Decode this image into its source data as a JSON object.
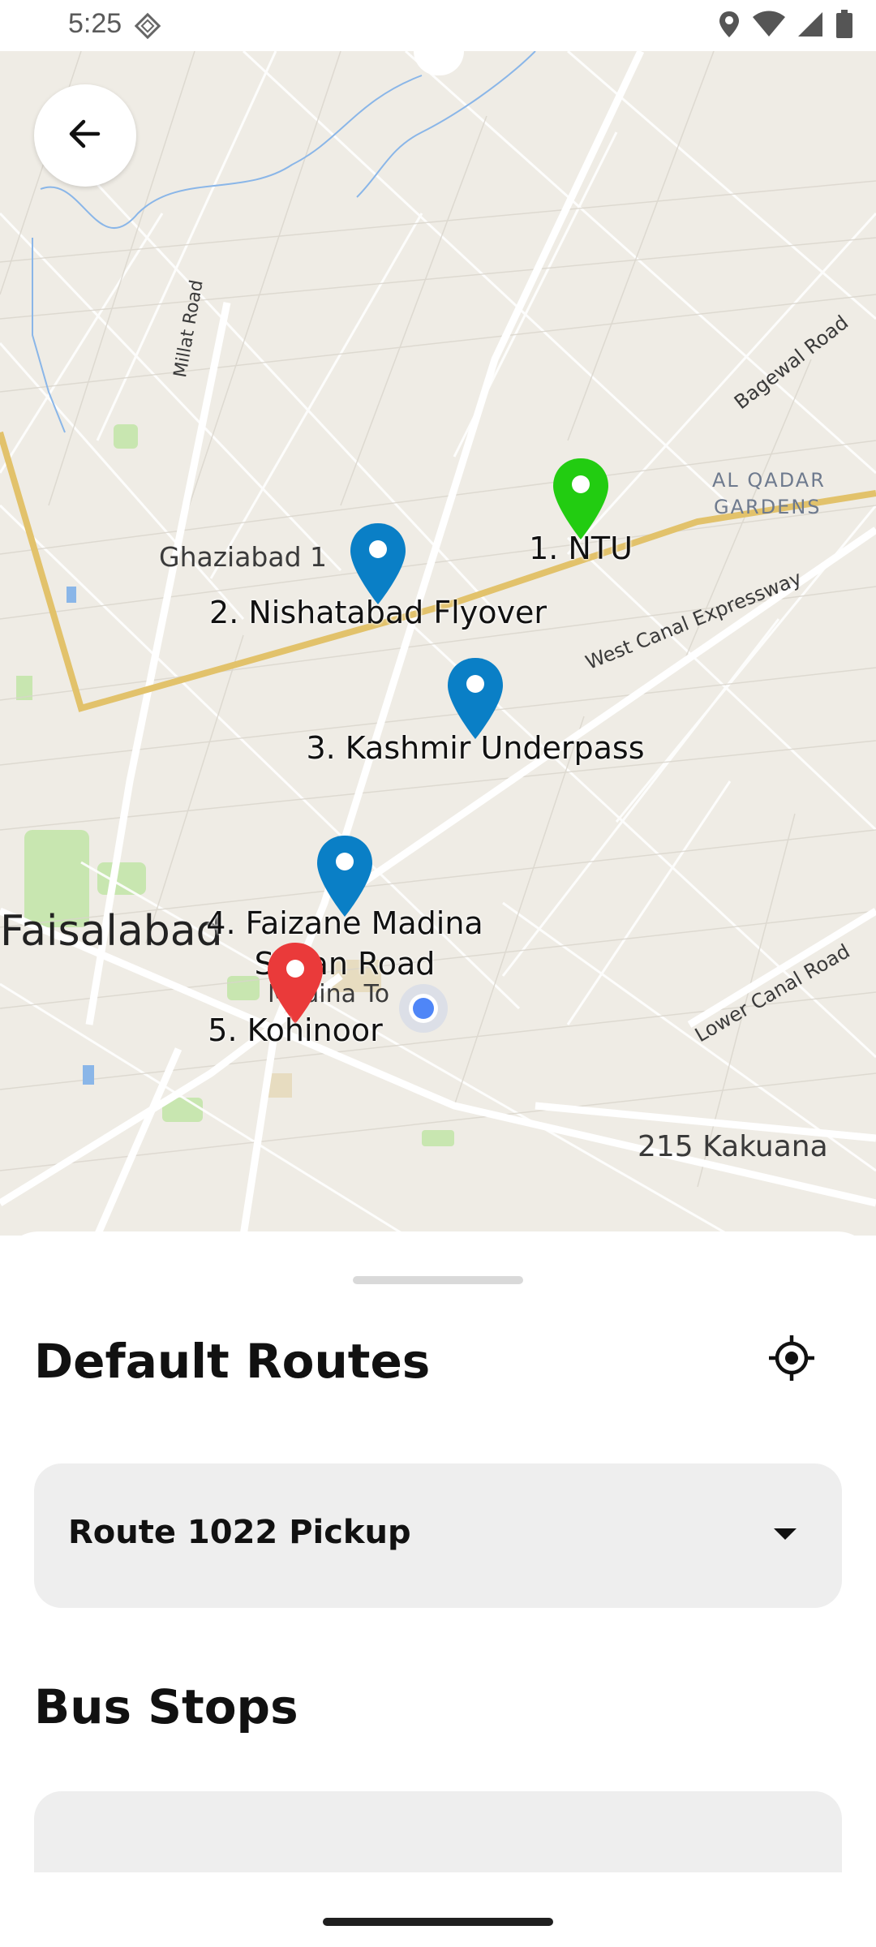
{
  "status_bar": {
    "time": "5:25",
    "left_icon": "screenshot-icon",
    "icons": [
      "location-icon",
      "wifi-icon",
      "signal-icon",
      "battery-icon"
    ]
  },
  "map": {
    "area_labels": {
      "city": "Faisalabad",
      "ghaziabad": "Ghaziabad 1",
      "millat_road": "Millat Road",
      "bagewal_road": "Bagewal Road",
      "al_qadar_1": "AL QADAR",
      "al_qadar_2": "GARDENS",
      "west_canal": "West Canal Expressway",
      "lower_canal": "Lower Canal Road",
      "kakuana": "215 Kakuana",
      "madina_town": "Madina To"
    },
    "stops": [
      {
        "label": "1. NTU",
        "color": "#22cc11"
      },
      {
        "label": "2. Nishatabad Flyover",
        "color": "#0a7fc6"
      },
      {
        "label": "3. Kashmir Underpass",
        "color": "#0a7fc6"
      },
      {
        "label_line1": "4. Faizane Madina",
        "label_line2": "Susan Road",
        "color": "#0a7fc6"
      },
      {
        "label": "5. Kohinoor",
        "color": "#ea3a3a"
      }
    ],
    "current_location_color": "#4f86f7"
  },
  "back_button_icon": "arrow-left-icon",
  "sheet": {
    "default_routes_title": "Default Routes",
    "locate_icon": "my-location-icon",
    "route_selected": "Route 1022 Pickup",
    "bus_stops_title": "Bus Stops"
  }
}
